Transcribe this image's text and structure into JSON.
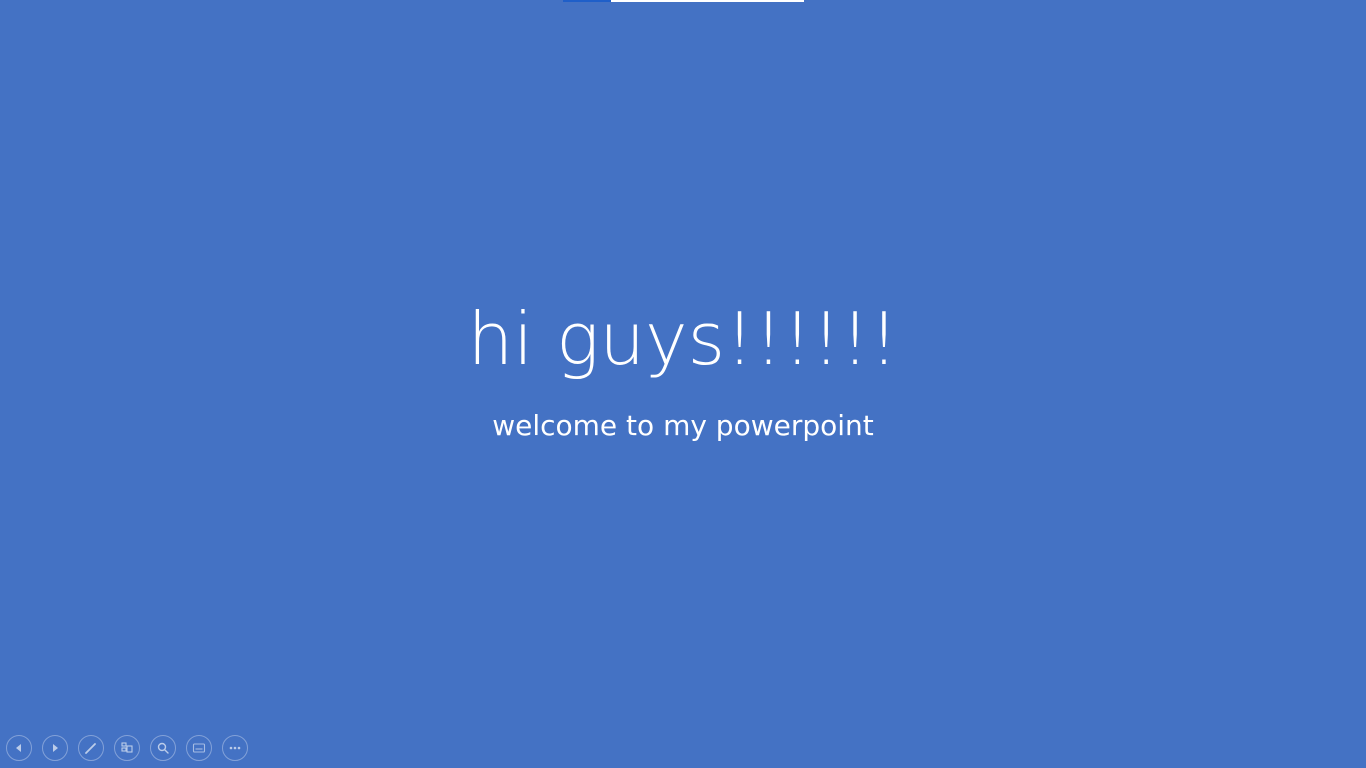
{
  "slide": {
    "title": "hi guys!!!!!!",
    "subtitle": "welcome to my powerpoint",
    "background_color": "#4472c4",
    "text_color": "#ffffff"
  },
  "progress": {
    "fraction": 0.2
  },
  "controls": [
    {
      "name": "previous-slide-button",
      "icon": "arrow-left-icon"
    },
    {
      "name": "next-slide-button",
      "icon": "arrow-right-icon"
    },
    {
      "name": "pen-button",
      "icon": "pen-icon"
    },
    {
      "name": "see-all-slides-button",
      "icon": "slides-grid-icon"
    },
    {
      "name": "zoom-button",
      "icon": "magnifier-icon"
    },
    {
      "name": "subtitles-button",
      "icon": "subtitles-icon"
    },
    {
      "name": "more-options-button",
      "icon": "ellipsis-icon"
    }
  ]
}
